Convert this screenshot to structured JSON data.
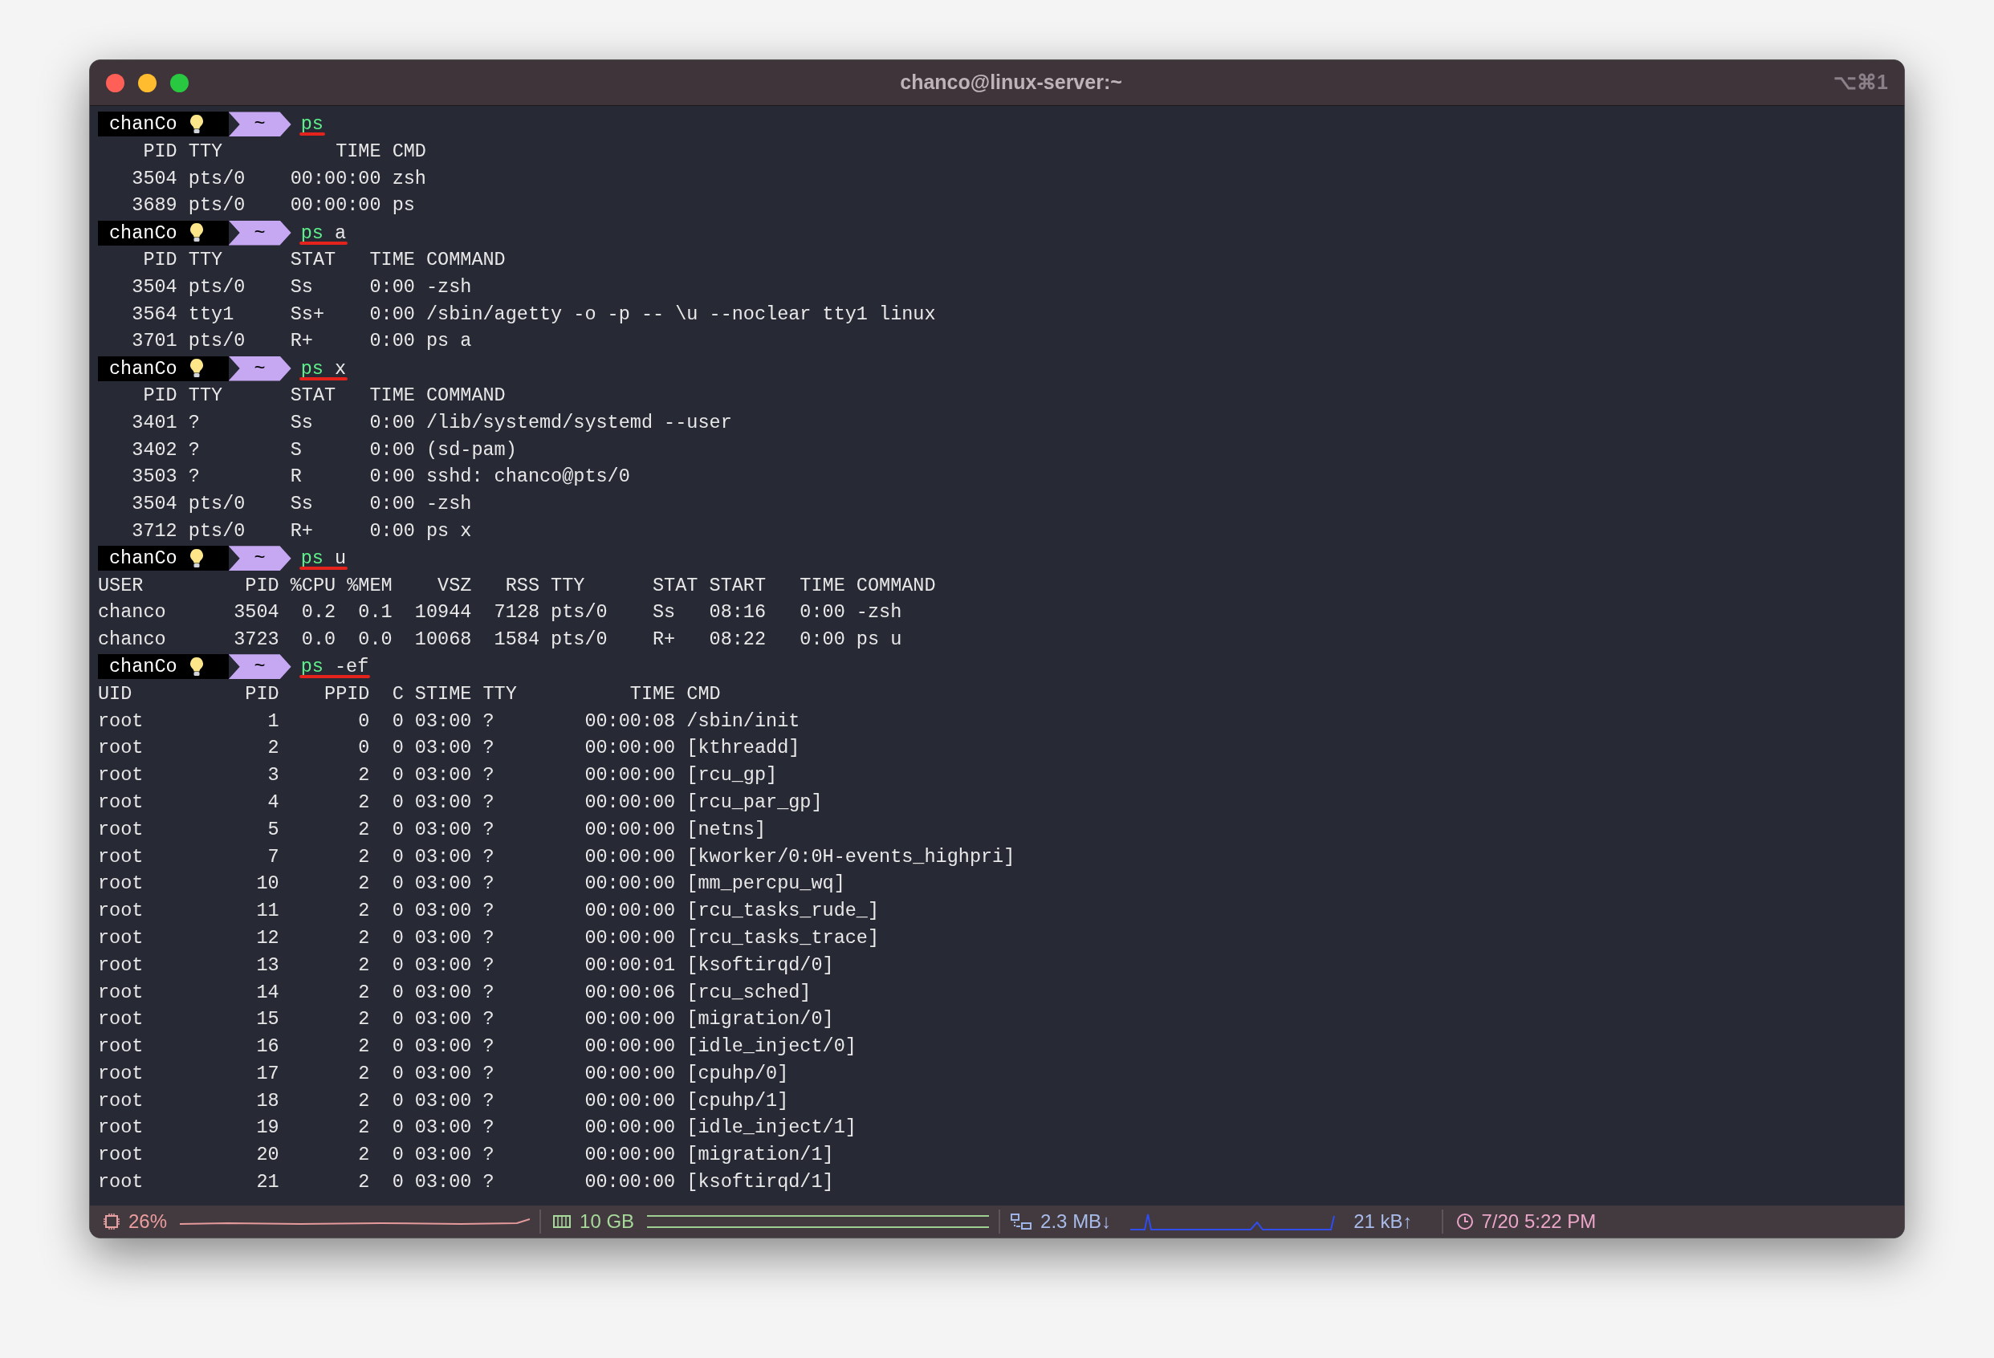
{
  "window": {
    "title": "chanco@linux-server:~",
    "shortcut": "⌥⌘1"
  },
  "sessions": [
    {
      "prompt": {
        "user": "chanCo",
        "dir": "~"
      },
      "command": {
        "name": "ps",
        "underlined": true
      },
      "output": [
        "    PID TTY          TIME CMD",
        "   3504 pts/0    00:00:00 zsh",
        "   3689 pts/0    00:00:00 ps"
      ]
    },
    {
      "prompt": {
        "user": "chanCo",
        "dir": "~"
      },
      "command": {
        "name": "ps",
        "args": "a",
        "underlined": true
      },
      "output": [
        "    PID TTY      STAT   TIME COMMAND",
        "   3504 pts/0    Ss     0:00 -zsh",
        "   3564 tty1     Ss+    0:00 /sbin/agetty -o -p -- \\u --noclear tty1 linux",
        "   3701 pts/0    R+     0:00 ps a"
      ]
    },
    {
      "prompt": {
        "user": "chanCo",
        "dir": "~"
      },
      "command": {
        "name": "ps",
        "args": "x",
        "underlined": true
      },
      "output": [
        "    PID TTY      STAT   TIME COMMAND",
        "   3401 ?        Ss     0:00 /lib/systemd/systemd --user",
        "   3402 ?        S      0:00 (sd-pam)",
        "   3503 ?        R      0:00 sshd: chanco@pts/0",
        "   3504 pts/0    Ss     0:00 -zsh",
        "   3712 pts/0    R+     0:00 ps x"
      ]
    },
    {
      "prompt": {
        "user": "chanCo",
        "dir": "~"
      },
      "command": {
        "name": "ps",
        "args": "u",
        "underlined": true
      },
      "output": [
        "USER         PID %CPU %MEM    VSZ   RSS TTY      STAT START   TIME COMMAND",
        "chanco      3504  0.2  0.1  10944  7128 pts/0    Ss   08:16   0:00 -zsh",
        "chanco      3723  0.0  0.0  10068  1584 pts/0    R+   08:22   0:00 ps u"
      ]
    },
    {
      "prompt": {
        "user": "chanCo",
        "dir": "~"
      },
      "command": {
        "name": "ps",
        "args": "-ef",
        "underlined": true
      },
      "output": [
        "UID          PID    PPID  C STIME TTY          TIME CMD",
        "root           1       0  0 03:00 ?        00:00:08 /sbin/init",
        "root           2       0  0 03:00 ?        00:00:00 [kthreadd]",
        "root           3       2  0 03:00 ?        00:00:00 [rcu_gp]",
        "root           4       2  0 03:00 ?        00:00:00 [rcu_par_gp]",
        "root           5       2  0 03:00 ?        00:00:00 [netns]",
        "root           7       2  0 03:00 ?        00:00:00 [kworker/0:0H-events_highpri]",
        "root          10       2  0 03:00 ?        00:00:00 [mm_percpu_wq]",
        "root          11       2  0 03:00 ?        00:00:00 [rcu_tasks_rude_]",
        "root          12       2  0 03:00 ?        00:00:00 [rcu_tasks_trace]",
        "root          13       2  0 03:00 ?        00:00:01 [ksoftirqd/0]",
        "root          14       2  0 03:00 ?        00:00:06 [rcu_sched]",
        "root          15       2  0 03:00 ?        00:00:00 [migration/0]",
        "root          16       2  0 03:00 ?        00:00:00 [idle_inject/0]",
        "root          17       2  0 03:00 ?        00:00:00 [cpuhp/0]",
        "root          18       2  0 03:00 ?        00:00:00 [cpuhp/1]",
        "root          19       2  0 03:00 ?        00:00:00 [idle_inject/1]",
        "root          20       2  0 03:00 ?        00:00:00 [migration/1]",
        "root          21       2  0 03:00 ?        00:00:00 [ksoftirqd/1]"
      ]
    }
  ],
  "status_bar": {
    "cpu": "26%",
    "memory": "10 GB",
    "download": "2.3 MB↓",
    "upload": "21 kB↑",
    "clock": "7/20 5:22 PM"
  }
}
